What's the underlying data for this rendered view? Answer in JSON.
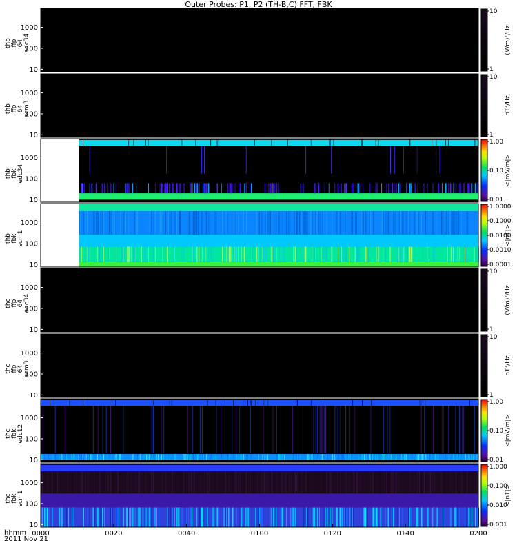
{
  "chart_data": {
    "type": "heatmap",
    "title": "Outer Probes: P1, P2 (TH-B,C) FFT, FBK",
    "x_axis": {
      "label_line1": "hhmm",
      "label_line2": "2011 Nov 21",
      "tick_labels": [
        "0000",
        "0020",
        "0040",
        "0100",
        "0120",
        "0140",
        "0200"
      ],
      "range_minutes": [
        0,
        120
      ]
    },
    "panels": [
      {
        "label_lines": [
          "thb",
          "ffp",
          "64",
          "edc34"
        ],
        "y_ticks": [
          "1000",
          "100",
          "10"
        ],
        "colorbar_ticks": [
          "10",
          "1"
        ],
        "colorbar_label": "(V/m)²/Hz",
        "colorbar": "dark",
        "content": "black"
      },
      {
        "label_lines": [
          "thb",
          "ffp",
          "64",
          "scm3"
        ],
        "y_ticks": [
          "1000",
          "100",
          "10"
        ],
        "colorbar_ticks": [
          "10",
          "1"
        ],
        "colorbar_label": "nT²/Hz",
        "colorbar": "dark",
        "content": "black"
      },
      {
        "label_lines": [
          "thb",
          "fbk",
          "edc34"
        ],
        "y_ticks": [
          "1000",
          "100",
          "10"
        ],
        "colorbar_ticks": [
          "1.00",
          "0.10",
          "0.01"
        ],
        "colorbar_label": "<|mV/m|>",
        "colorbar": "rainbow",
        "content": "fbk_e_b",
        "data_start_minutes": 10.5
      },
      {
        "label_lines": [
          "thb",
          "fbk",
          "scm1"
        ],
        "y_ticks": [
          "1000",
          "100",
          "10"
        ],
        "colorbar_ticks": [
          "1.0000",
          "0.1000",
          "0.0100",
          "0.0010",
          "0.0001"
        ],
        "colorbar_label": "<|nT|>",
        "colorbar": "rainbow",
        "content": "fbk_b_b",
        "data_start_minutes": 10.5
      },
      {
        "label_lines": [
          "thc",
          "ffp",
          "64",
          "edc34"
        ],
        "y_ticks": [
          "1000",
          "100",
          "10"
        ],
        "colorbar_ticks": [
          "10",
          "1"
        ],
        "colorbar_label": "(V/m)²/Hz",
        "colorbar": "dark",
        "content": "black"
      },
      {
        "label_lines": [
          "thc",
          "ffp",
          "64",
          "scm3"
        ],
        "y_ticks": [
          "1000",
          "100",
          "10"
        ],
        "colorbar_ticks": [
          "10",
          "1"
        ],
        "colorbar_label": "nT²/Hz",
        "colorbar": "dark",
        "content": "black"
      },
      {
        "label_lines": [
          "thc",
          "fbk",
          "edc12"
        ],
        "y_ticks": [
          "1000",
          "100",
          "10"
        ],
        "colorbar_ticks": [
          "1.00",
          "0.10",
          "0.01"
        ],
        "colorbar_label": "<|mV/m|>",
        "colorbar": "rainbow",
        "content": "fbk_e_c",
        "data_start_minutes": 0
      },
      {
        "label_lines": [
          "thc",
          "fbk",
          "scm1"
        ],
        "y_ticks": [
          "1000",
          "100",
          "10"
        ],
        "colorbar_ticks": [
          "1.000",
          "0.100",
          "0.010",
          "0.001"
        ],
        "colorbar_label": "<|nT|>",
        "colorbar": "rainbow",
        "content": "fbk_b_c",
        "data_start_minutes": 0
      }
    ]
  }
}
